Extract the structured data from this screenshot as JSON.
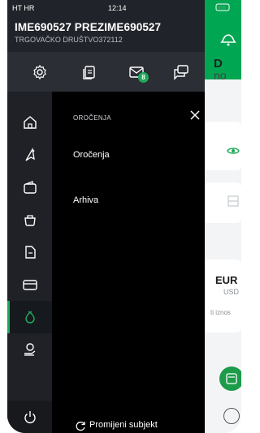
{
  "status_bar": {
    "carrier": "HT HR",
    "time": "12:14"
  },
  "drawer": {
    "user_name": "IME690527 PREZIME690527",
    "company": "TRGOVAČKO DRUŠTVO372112",
    "quick_actions": {
      "settings_icon": "gear-icon",
      "documents_icon": "documents-icon",
      "messages_icon": "envelope-icon",
      "messages_badge": "8",
      "chat_icon": "chat-icon"
    },
    "rail": [
      "home-icon",
      "payment-icon",
      "wallet-icon",
      "savings-pot-icon",
      "document-icon",
      "card-icon",
      "deposit-icon",
      "loan-icon",
      "power-icon"
    ],
    "submenu": {
      "title": "OROČENJA",
      "items": [
        {
          "label": "Oročenja"
        },
        {
          "label": "Arhiva"
        }
      ],
      "switch_subject": "Promijeni subjekt"
    }
  },
  "background": {
    "peek_line1": "D",
    "peek_line2": "no",
    "currency": "EUR",
    "currency_secondary": "USD",
    "amount_label": "ti iznos"
  },
  "colors": {
    "accent": "#1ea85a",
    "drawer_bg": "#000000",
    "header_bg": "#202329",
    "rail_bg": "#1f2126",
    "app_green": "#00a651"
  }
}
